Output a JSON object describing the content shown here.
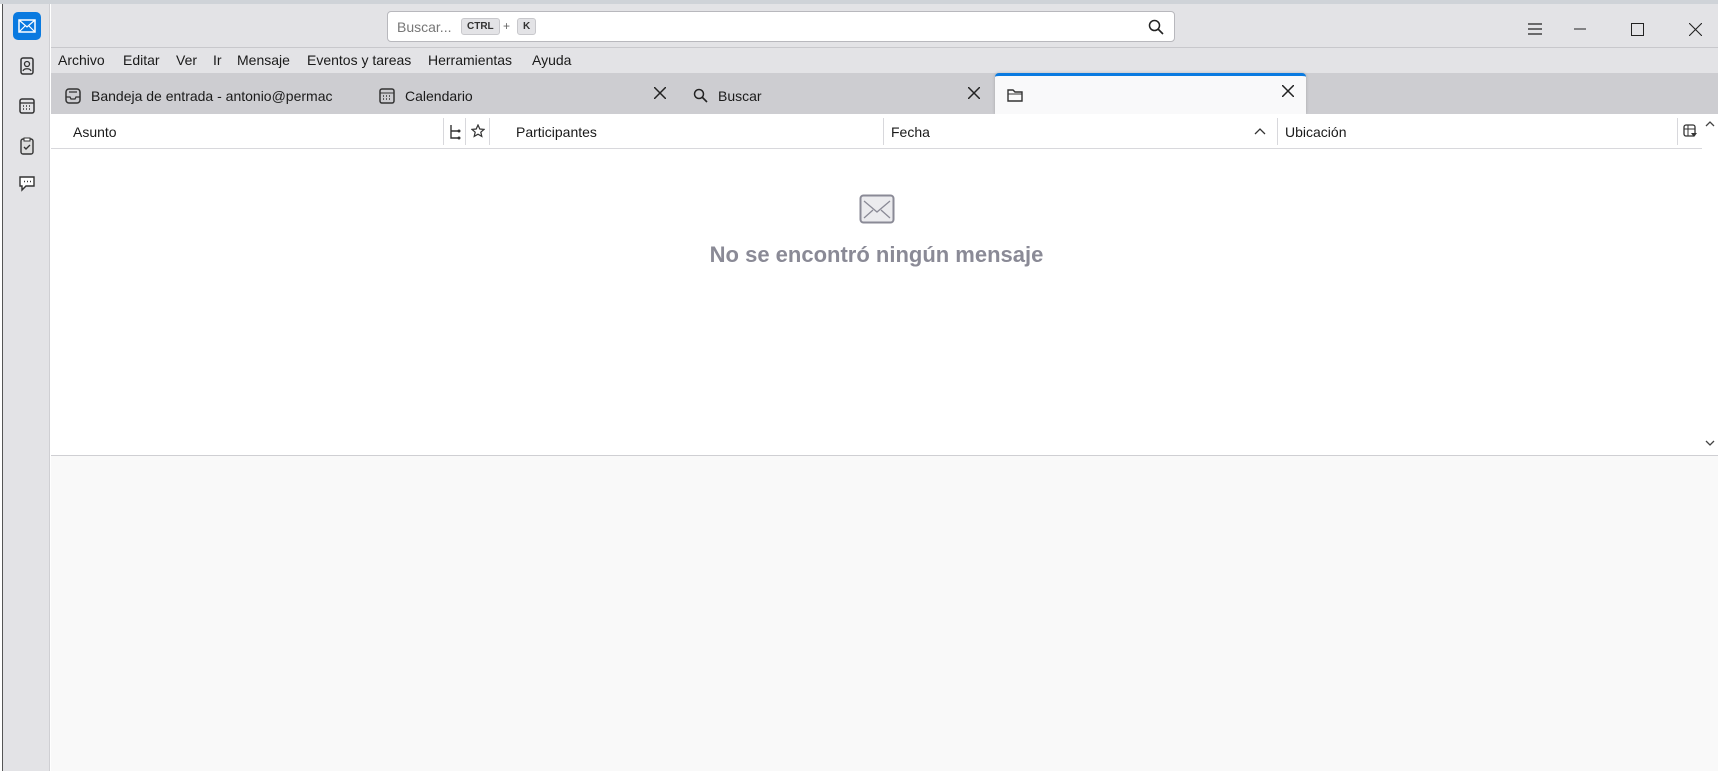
{
  "search": {
    "placeholder": "Buscar...",
    "shortcut_mod": "CTRL",
    "shortcut_plus": "+",
    "shortcut_key": "K"
  },
  "menu": [
    "Archivo",
    "Editar",
    "Ver",
    "Ir",
    "Mensaje",
    "Eventos y tareas",
    "Herramientas",
    "Ayuda"
  ],
  "tabs": [
    {
      "label": "Bandeja de entrada - antonio@permac"
    },
    {
      "label": "Calendario"
    },
    {
      "label": "Buscar"
    },
    {
      "label": ""
    }
  ],
  "columns": {
    "subject": "Asunto",
    "participants": "Participantes",
    "date": "Fecha",
    "location": "Ubicación"
  },
  "empty": {
    "message": "No se encontró ningún mensaje"
  },
  "colors": {
    "accent": "#0a7ae0"
  }
}
